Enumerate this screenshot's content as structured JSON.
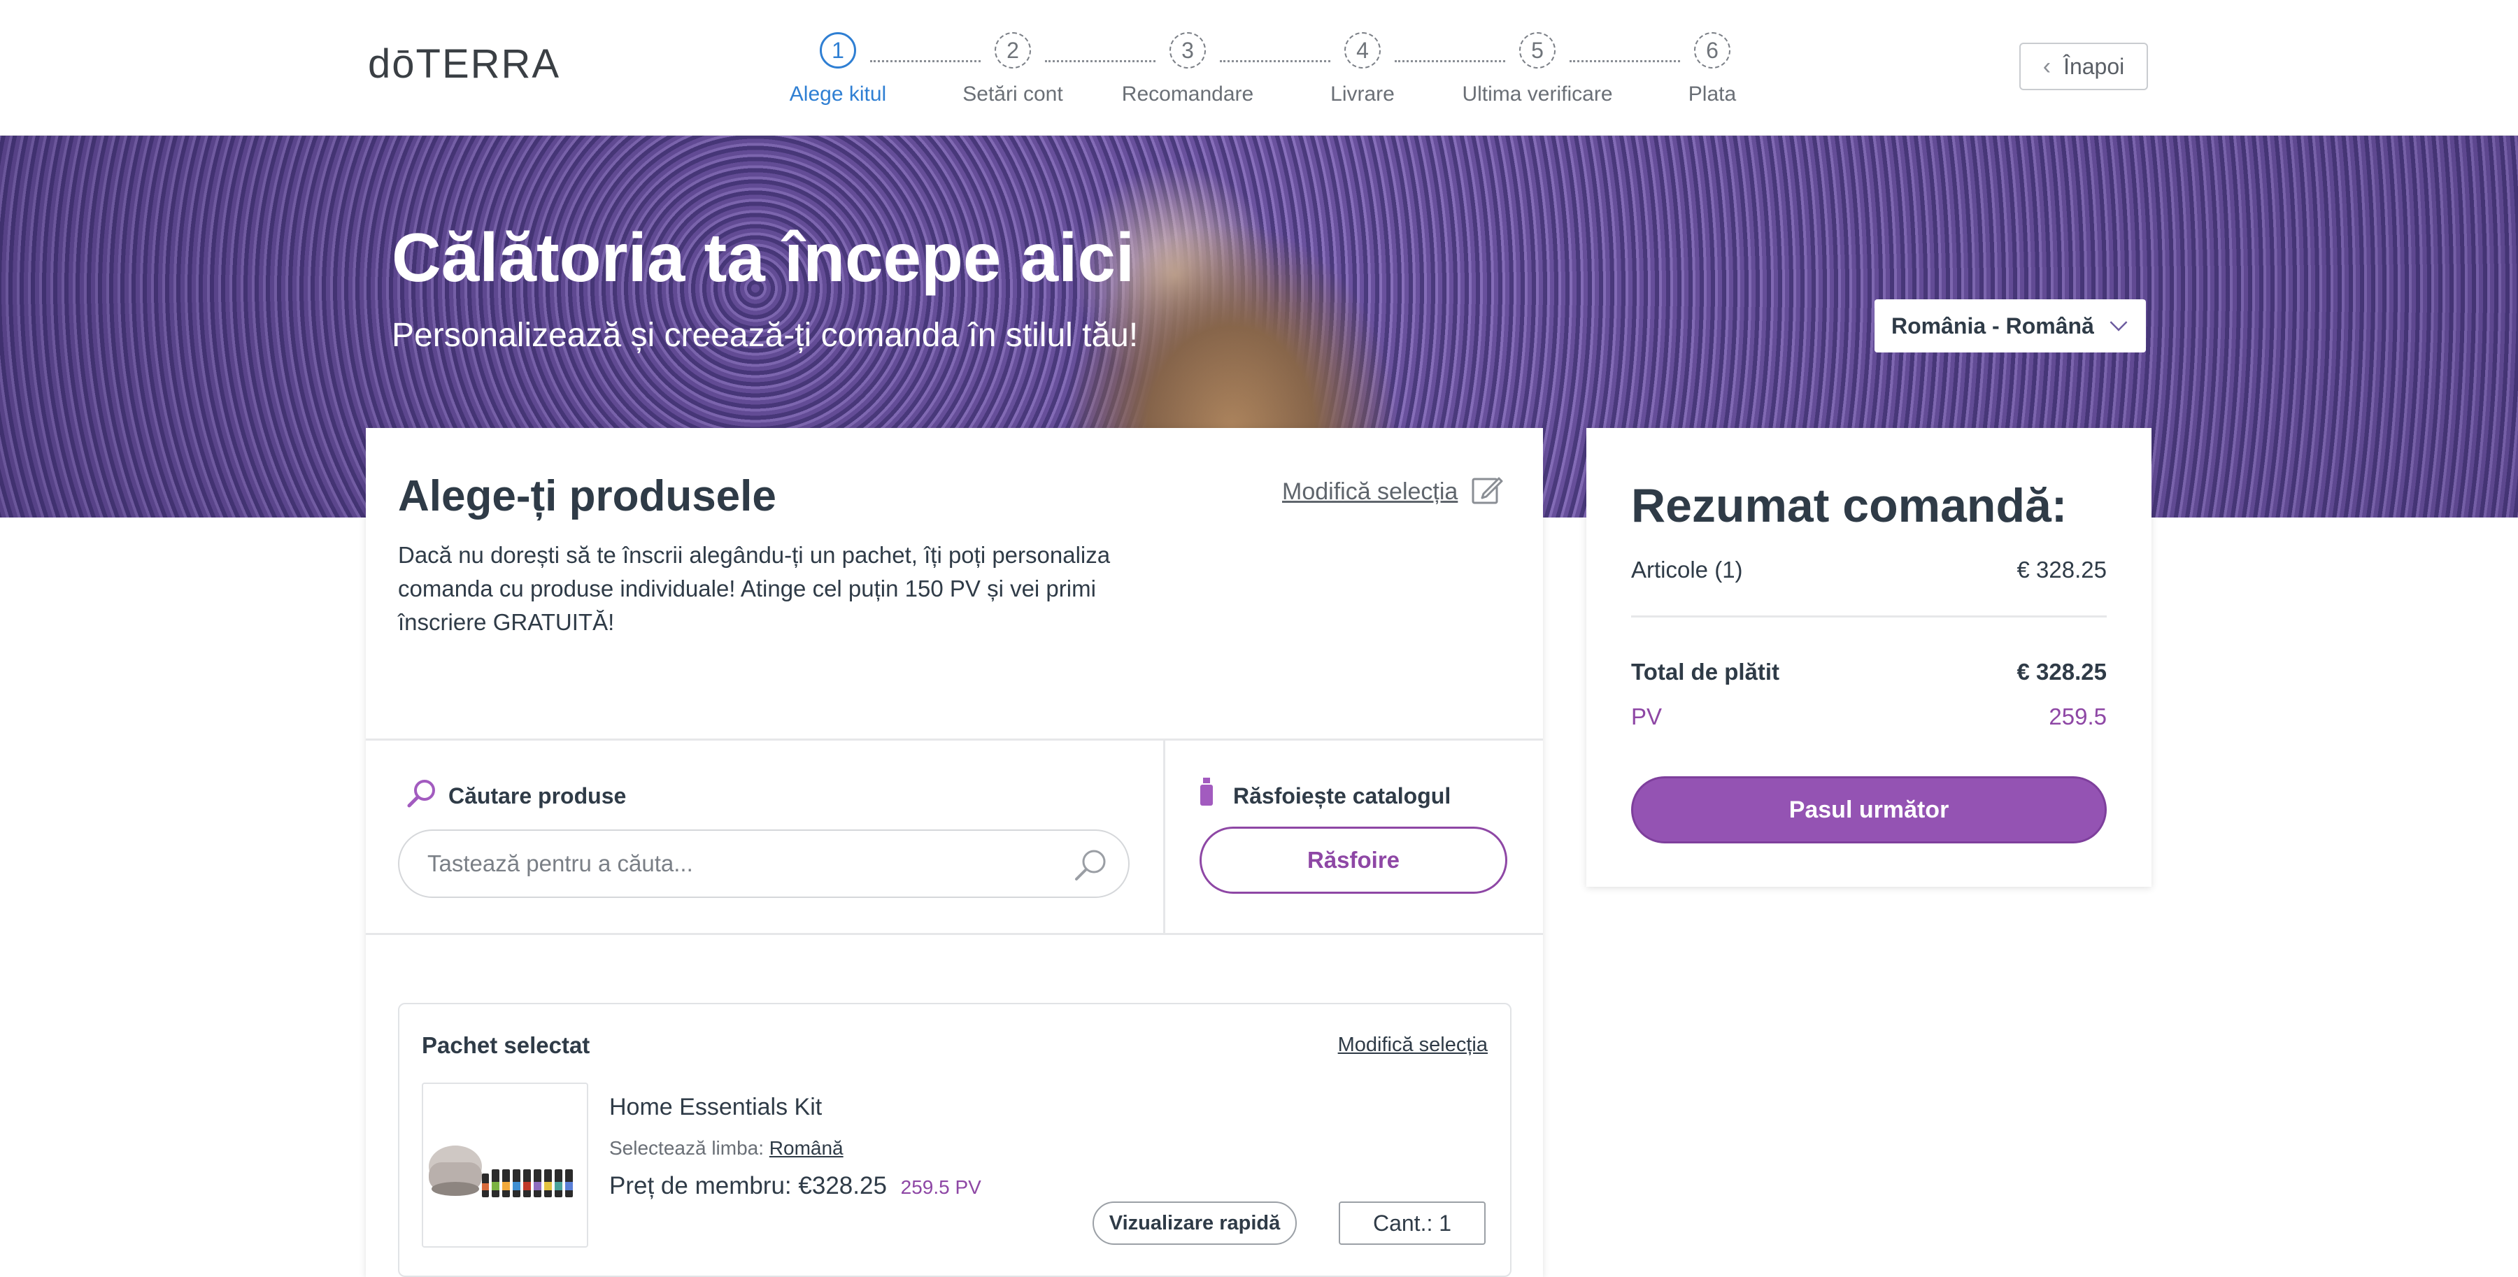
{
  "header": {
    "logo": "dōTERRA",
    "back_label": "Înapoi",
    "steps": [
      {
        "number": "1",
        "label": "Alege kitul",
        "active": true
      },
      {
        "number": "2",
        "label": "Setări cont",
        "active": false
      },
      {
        "number": "3",
        "label": "Recomandare",
        "active": false
      },
      {
        "number": "4",
        "label": "Livrare",
        "active": false
      },
      {
        "number": "5",
        "label": "Ultima verificare",
        "active": false
      },
      {
        "number": "6",
        "label": "Plata",
        "active": false
      }
    ]
  },
  "hero": {
    "title": "Călătoria ta începe aici",
    "subtitle": "Personalizează și creează-ți comanda în stilul tău!",
    "language_selected": "România - Română"
  },
  "products": {
    "title": "Alege-ți produsele",
    "modify_label": "Modifică selecția",
    "intro": "Dacă nu dorești să te înscrii alegându-ți un pachet, îți poți personaliza comanda cu produse individuale! Atinge cel puțin 150 PV și vei primi înscriere GRATUITĂ!",
    "search": {
      "label": "Căutare produse",
      "placeholder": "Tastează pentru a căuta..."
    },
    "browse": {
      "label": "Răsfoiește catalogul",
      "button": "Răsfoire"
    },
    "package": {
      "title": "Pachet selectat",
      "modify_label": "Modifică selecția",
      "product_name": "Home Essentials Kit",
      "language_prefix": "Selectează limba:",
      "language_value": "Română",
      "price_label": "Preț de membru:",
      "price_value": "€328.25",
      "pv_value": "259.5 PV",
      "quick_view": "Vizualizare rapidă",
      "quantity": "Cant.: 1"
    }
  },
  "summary": {
    "title": "Rezumat comandă:",
    "items_label": "Articole (1)",
    "items_value": "€ 328.25",
    "total_label": "Total de plătit",
    "total_value": "€ 328.25",
    "pv_label": "PV",
    "pv_value": "259.5",
    "next_button": "Pasul următor"
  },
  "colors": {
    "accent_purple": "#8e47a5",
    "step_active_blue": "#2f7fd3",
    "text_dark": "#2f3b47"
  }
}
